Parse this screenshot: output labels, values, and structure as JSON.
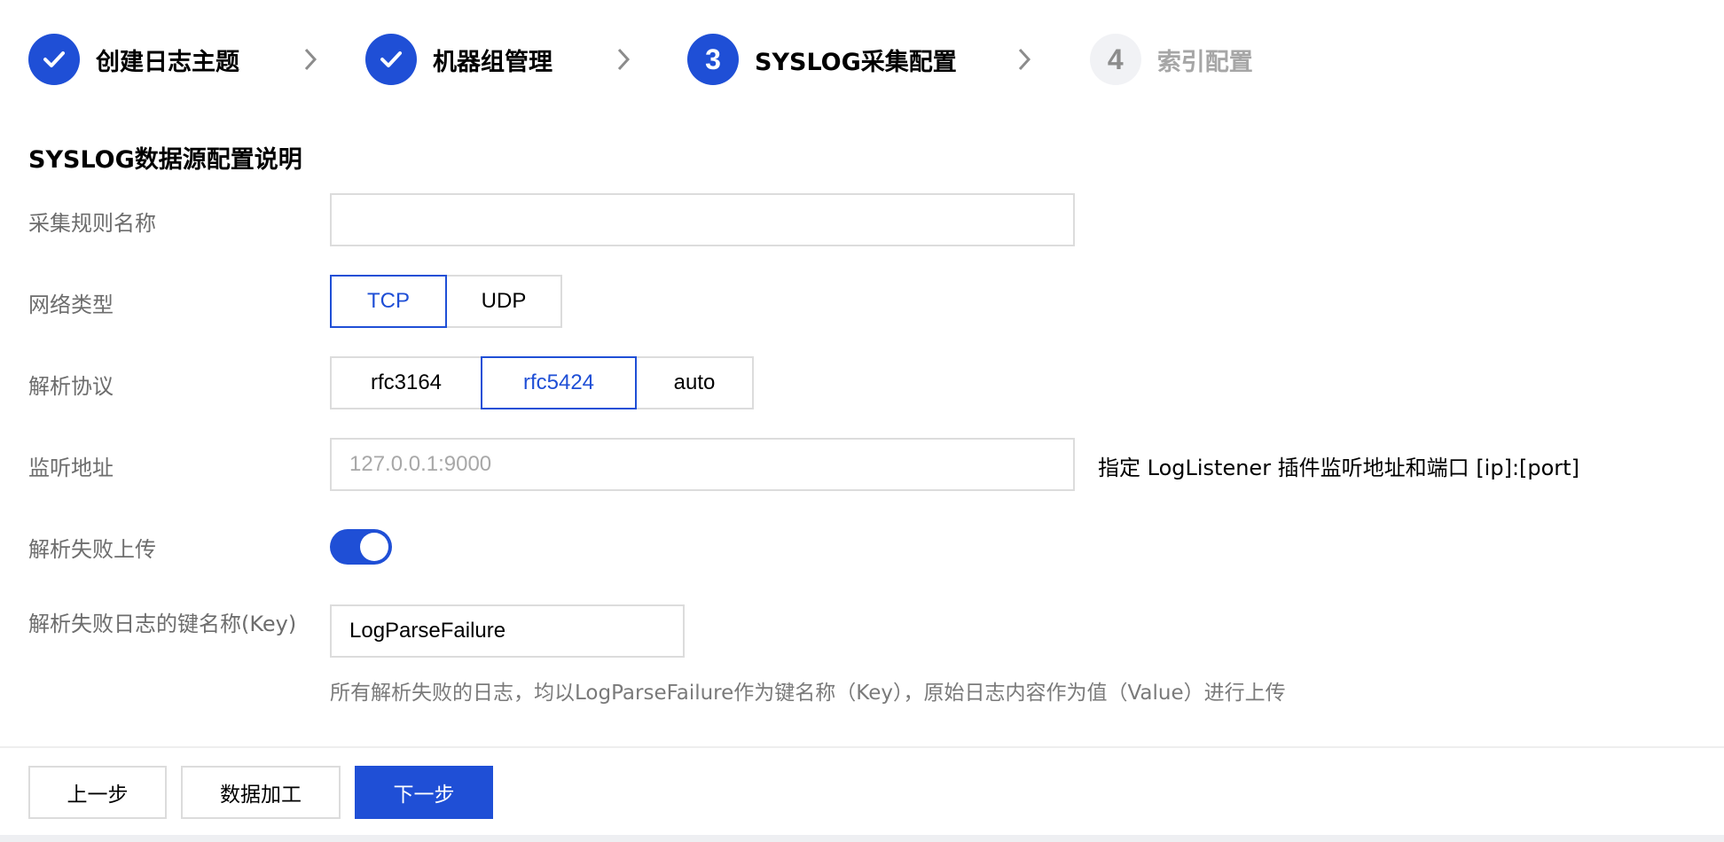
{
  "steps": [
    {
      "number": "",
      "label": "创建日志主题",
      "status": "done"
    },
    {
      "number": "",
      "label": "机器组管理",
      "status": "done"
    },
    {
      "number": "3",
      "label": "SYSLOG采集配置",
      "status": "active"
    },
    {
      "number": "4",
      "label": "索引配置",
      "status": "pending"
    }
  ],
  "section_title": "SYSLOG数据源配置说明",
  "form": {
    "rule_name": {
      "label": "采集规则名称",
      "value": "",
      "placeholder": ""
    },
    "network_type": {
      "label": "网络类型",
      "options": [
        "TCP",
        "UDP"
      ],
      "selected": "TCP"
    },
    "protocol": {
      "label": "解析协议",
      "options": [
        "rfc3164",
        "rfc5424",
        "auto"
      ],
      "selected": "rfc5424"
    },
    "listen_address": {
      "label": "监听地址",
      "value": "",
      "placeholder": "127.0.0.1:9000",
      "hint": "指定 LogListener 插件监听地址和端口 [ip]:[port]"
    },
    "upload_on_fail": {
      "label": "解析失败上传",
      "enabled": true
    },
    "fail_key": {
      "label": "解析失败日志的键名称(Key)",
      "value": "LogParseFailure",
      "help": "所有解析失败的日志，均以LogParseFailure作为键名称（Key），原始日志内容作为值（Value）进行上传"
    }
  },
  "footer": {
    "prev_label": "上一步",
    "process_label": "数据加工",
    "next_label": "下一步"
  },
  "colors": {
    "accent": "#1f4fd6",
    "pending_circle": "#f1f2f5",
    "border": "#dcdcdc"
  },
  "icons": {
    "done": "checkmark-icon",
    "separator": "chevron-right-icon"
  }
}
